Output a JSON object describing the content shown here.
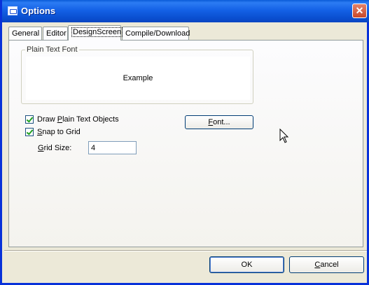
{
  "window": {
    "title": "Options",
    "close_symbol": "✕"
  },
  "tabs": [
    {
      "label": "General"
    },
    {
      "label": "Editor"
    },
    {
      "label": "DesignScreen",
      "active": true
    },
    {
      "label": "Compile/Download"
    }
  ],
  "plain_text_font": {
    "group_label": "Plain Text Font",
    "example_text": "Example"
  },
  "options": {
    "draw_plain_text_objects": {
      "label_prefix": "Draw ",
      "label_mnemonic": "P",
      "label_suffix": "lain Text Objects",
      "checked": true
    },
    "snap_to_grid": {
      "label_mnemonic": "S",
      "label_suffix": "nap to Grid",
      "checked": true
    },
    "grid_size": {
      "label_mnemonic": "G",
      "label_suffix": "rid Size:",
      "value": "4"
    }
  },
  "font_button": {
    "mnemonic": "F",
    "suffix": "ont..."
  },
  "buttons": {
    "ok_label": "OK",
    "cancel_mnemonic": "C",
    "cancel_suffix": "ancel"
  },
  "icons": {
    "window_icon": "app-window-icon",
    "pointer": "mouse-pointer-icon"
  },
  "colors": {
    "titlebar": "#0a4fd0",
    "close_button": "#c8482a",
    "dialog_background": "#ece9d8"
  }
}
